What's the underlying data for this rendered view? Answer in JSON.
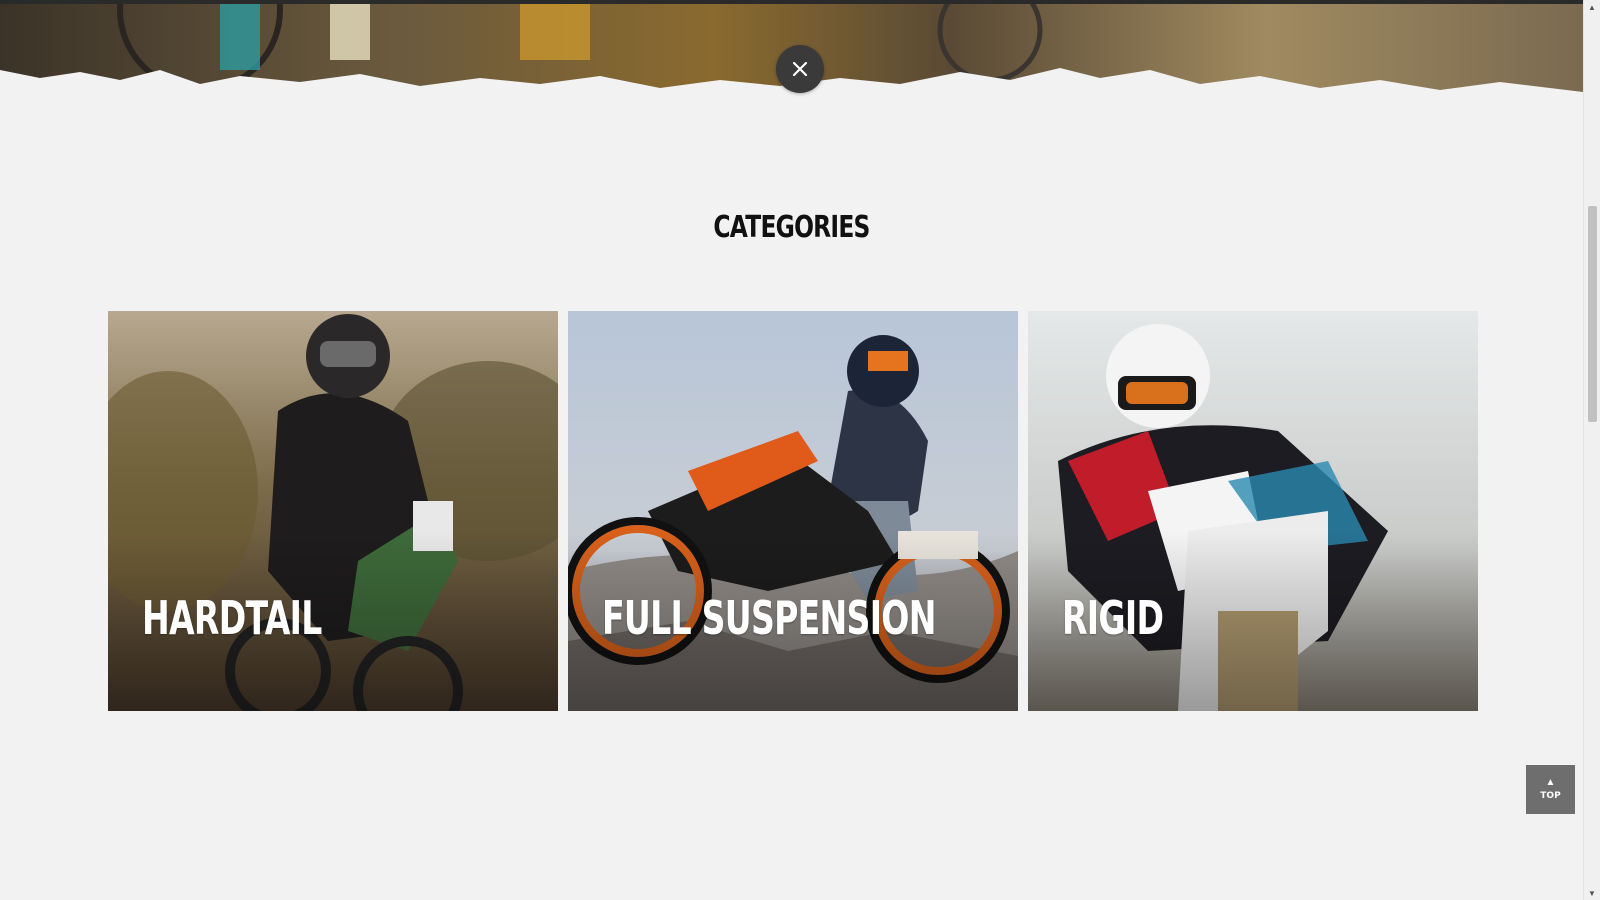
{
  "hero": {
    "close_icon": "close-icon"
  },
  "categories": {
    "title": "CATEGORIES",
    "items": [
      {
        "label": "HARDTAIL"
      },
      {
        "label": "FULL SUSPENSION"
      },
      {
        "label": "RIGID"
      }
    ]
  },
  "back_to_top": {
    "icon": "chevron-up-icon",
    "label": "TOP"
  },
  "colors": {
    "background": "#f2f2f2",
    "title_text": "#111111",
    "card_text": "#ffffff",
    "close_button": "#3a3a3a",
    "top_button": "#6e6e6e"
  }
}
